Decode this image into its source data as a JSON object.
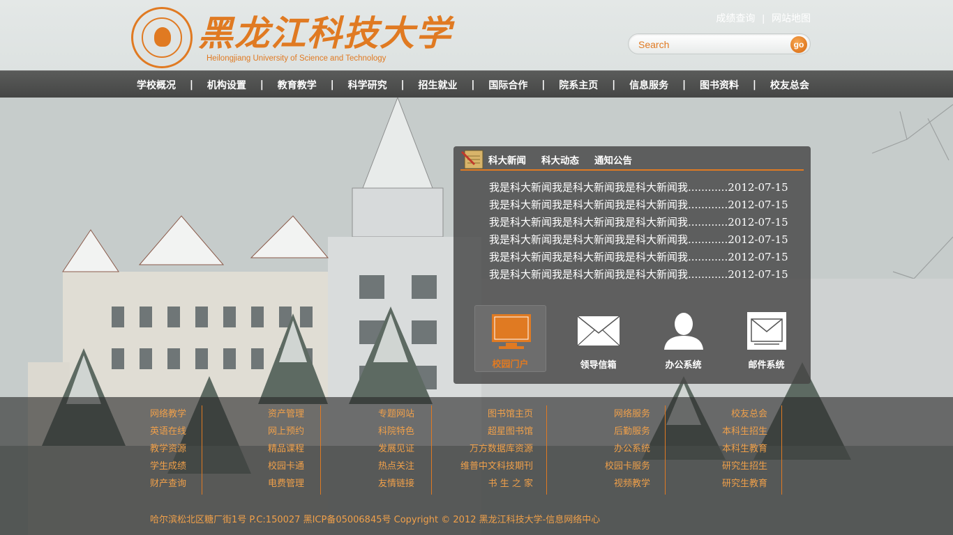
{
  "brand": {
    "logo_title": "黑龙江科技大学",
    "logo_subtitle": "Heilongjiang University of Science and Technology"
  },
  "top_links": [
    {
      "label": "成绩查询"
    },
    {
      "label": "网站地图"
    }
  ],
  "top_link_separator": "|",
  "search": {
    "placeholder": "Search",
    "go_label": "go"
  },
  "nav": {
    "separator": "|",
    "items": [
      {
        "label": "学校概况"
      },
      {
        "label": "机构设置"
      },
      {
        "label": "教育教学"
      },
      {
        "label": "科学研究"
      },
      {
        "label": "招生就业"
      },
      {
        "label": "国际合作"
      },
      {
        "label": "院系主页"
      },
      {
        "label": "信息服务"
      },
      {
        "label": "图书资料"
      },
      {
        "label": "校友总会"
      }
    ]
  },
  "news": {
    "tabs": [
      {
        "label": "科大新闻"
      },
      {
        "label": "科大动态"
      },
      {
        "label": "通知公告"
      }
    ],
    "items": [
      {
        "text": "我是科大新闻我是科大新闻我是科大新闻我............2012-07-15"
      },
      {
        "text": "我是科大新闻我是科大新闻我是科大新闻我............2012-07-15"
      },
      {
        "text": "我是科大新闻我是科大新闻我是科大新闻我............2012-07-15"
      },
      {
        "text": "我是科大新闻我是科大新闻我是科大新闻我............2012-07-15"
      },
      {
        "text": "我是科大新闻我是科大新闻我是科大新闻我............2012-07-15"
      },
      {
        "text": "我是科大新闻我是科大新闻我是科大新闻我............2012-07-15"
      }
    ],
    "quick_links": [
      {
        "label": "校园门户",
        "icon": "monitor-icon",
        "active": true
      },
      {
        "label": "领导信箱",
        "icon": "envelope-icon",
        "active": false
      },
      {
        "label": "办公系统",
        "icon": "person-icon",
        "active": false
      },
      {
        "label": "邮件系统",
        "icon": "mailbox-icon",
        "active": false
      }
    ]
  },
  "footer": {
    "columns": [
      [
        "网络教学",
        "英语在线",
        "教学资源",
        "学生成绩",
        "财产查询"
      ],
      [
        "资产管理",
        "网上预约",
        "精品课程",
        "校园卡通",
        "电费管理"
      ],
      [
        "专题网站",
        "科院特色",
        "发展见证",
        "热点关注",
        "友情链接"
      ],
      [
        "图书馆主页",
        "超星图书馆",
        "万方数据库资源",
        "维普中文科技期刊",
        "书 生 之 家"
      ],
      [
        "网络服务",
        "后勤服务",
        "办公系统",
        "校园卡服务",
        "视频教学"
      ],
      [
        "校友总会",
        "本科生招生",
        "本科生教育",
        "研究生招生",
        "研究生教育"
      ]
    ],
    "copyright": "哈尔滨松北区糖厂街1号 P.C:150027  黑ICP备05006845号   Copyright © 2012  黑龙江科技大学-信息网络中心"
  },
  "colors": {
    "accent": "#e07a22",
    "nav_bg": "#4d4e4d",
    "footer_text": "#f0a04a"
  }
}
